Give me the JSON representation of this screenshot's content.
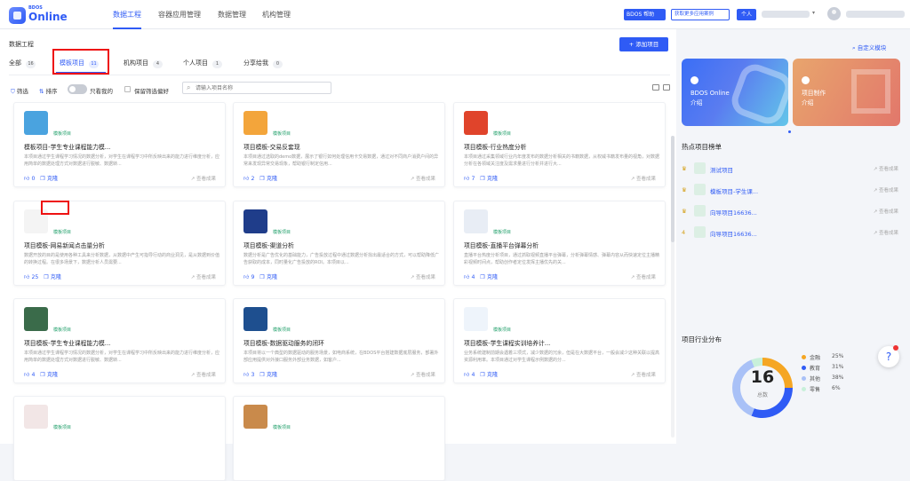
{
  "logo": {
    "small": "BDOS",
    "big": "Online"
  },
  "nav": [
    "数据工程",
    "容器应用管理",
    "数据管理",
    "机构管理"
  ],
  "header": {
    "help": "BDOS 帮助",
    "cases": "获取更多应用案例",
    "personal": "个人"
  },
  "page_title": "数据工程",
  "add_button": "+ 添加项目",
  "tabs": [
    {
      "label": "全部",
      "count": "16"
    },
    {
      "label": "模板项目",
      "count": "11"
    },
    {
      "label": "机构项目",
      "count": "4"
    },
    {
      "label": "个人项目",
      "count": "1"
    },
    {
      "label": "分享给我",
      "count": "0"
    }
  ],
  "filters": {
    "filter": "筛选",
    "sort": "排序",
    "mine": "只看我的",
    "keep": "保留筛选偏好",
    "search_placeholder": "请输入项目名称"
  },
  "cards": [
    {
      "tag": "模板项目",
      "title": "模板项目-学生专业课程能力模...",
      "desc": "本项目通过学生课程学习情况的数据分析，对学生在课程学习中所反映出来的能力进行维度分析，应用简单的数据处理方式对数据进行脱敏、数据转...",
      "likes": "0",
      "clone": "克隆",
      "view": "查看成果",
      "thumb": "#4aa3df"
    },
    {
      "tag": "模板项目",
      "title": "项目模板-交易反套现",
      "desc": "本项目通过选取的demo数据，展示了银行如何处理信用卡交易数据，通过对不同商户消费户间的异常来发现异常交易现象，帮助银行制定信用...",
      "likes": "2",
      "clone": "克隆",
      "view": "查看成果",
      "thumb": "#f3a53b"
    },
    {
      "tag": "模板项目",
      "title": "项目模板-行业热度分析",
      "desc": "本项目通过采集领域行业内年度发布的数据分析相关的书籍数据，从权威书籍发布量的视角，对数据分析在各领域关注度及需求量进行分析并进行大...",
      "likes": "7",
      "clone": "克隆",
      "view": "查看成果",
      "thumb": "#e0442b"
    },
    {
      "tag": "模板项目",
      "title": "项目模板-网易新闻点击量分析",
      "desc": "数据开放的目的是使用各种工具来分析数据，从数据中产生可指导行动的商业洞见，是从数据到价值的转换过程。在很多场景下，数据分析人员需要...",
      "likes": "25",
      "clone": "克隆",
      "view": "查看成果",
      "thumb": "#f4f4f4"
    },
    {
      "tag": "模板项目",
      "title": "项目模板-渠道分析",
      "desc": "数据分析是广告优化的基础能力，广告投放过程中通过数据分析找出最适合的方式，可以帮助降低广告获取的成本，同时量化广告投放的ROI。本项目以...",
      "likes": "9",
      "clone": "克隆",
      "view": "查看成果",
      "thumb": "#1f3d8a"
    },
    {
      "tag": "模板项目",
      "title": "项目模板-直播平台弹幕分析",
      "desc": "直播平台热度分析项目，通过抓取视频直播平台弹幕，分析弹幕情感、弹幕内容从而快速定位主播精彩视频时间点，帮助创作者定位发挥主播优先的关...",
      "likes": "4",
      "clone": "克隆",
      "view": "查看成果",
      "thumb": "#e8edf5"
    },
    {
      "tag": "模板项目",
      "title": "项目模板-学生专业课程能力模...",
      "desc": "本项目通过学生课程学习情况的数据分析，对学生在课程学习中所反映出来的能力进行维度分析，应用简单的数据处理方式对数据进行脱敏、数据转...",
      "likes": "4",
      "clone": "克隆",
      "view": "查看成果",
      "thumb": "#3a6b4a"
    },
    {
      "tag": "模板项目",
      "title": "项目模板-数据驱动服务的闭环",
      "desc": "本项目将以一个典型的数据驱动的服务场景，如电商系统，在BDOS平台搭建数据底层服务，部署外部应用提供对外接口服务外部业务数据，如客户...",
      "likes": "3",
      "clone": "克隆",
      "view": "查看成果",
      "thumb": "#1e4f8f"
    },
    {
      "tag": "模板项目",
      "title": "项目模板-学生课程实训培养计...",
      "desc": "业务系统建制前期会遇着三项式，减少数据的冗余，但是在大数据平台，一般会减少这种关联以提高资源利用率。本项目通过对学生课程示例数据的分...",
      "likes": "4",
      "clone": "克隆",
      "view": "查看成果",
      "thumb": "#eef4fb"
    },
    {
      "tag": "模板项目",
      "title": "",
      "desc": "",
      "likes": "",
      "clone": "",
      "view": "",
      "thumb": "#f2e6e6"
    },
    {
      "tag": "模板项目",
      "title": "",
      "desc": "",
      "likes": "",
      "clone": "",
      "view": "",
      "thumb": "#c98a4b"
    }
  ],
  "side": {
    "custom": "自定义模块",
    "banners": [
      {
        "text": "BDOS Online\n介绍"
      },
      {
        "text": "项目制作\n介绍"
      }
    ],
    "hot_title": "热点项目榜单",
    "hot": [
      {
        "rank": "♛",
        "name": "测试项目",
        "view": "查看成果"
      },
      {
        "rank": "♛",
        "name": "模板项目-学生课...",
        "view": "查看成果"
      },
      {
        "rank": "♛",
        "name": "向导项目16636...",
        "view": "查看成果"
      },
      {
        "rank": "4",
        "name": "向导项目16636...",
        "view": "查看成果"
      }
    ],
    "dist_title": "项目行业分布",
    "total": "16",
    "total_label": "总数"
  },
  "chart_data": {
    "type": "pie",
    "title": "项目行业分布",
    "categories": [
      "金融",
      "教育",
      "其他",
      "零售"
    ],
    "values": [
      25,
      31,
      38,
      6
    ],
    "labels": [
      "25%",
      "31%",
      "38%",
      "6%"
    ],
    "colors": [
      "#f5a623",
      "#2f5bf5",
      "#a9c1f7",
      "#c8f0da"
    ]
  }
}
